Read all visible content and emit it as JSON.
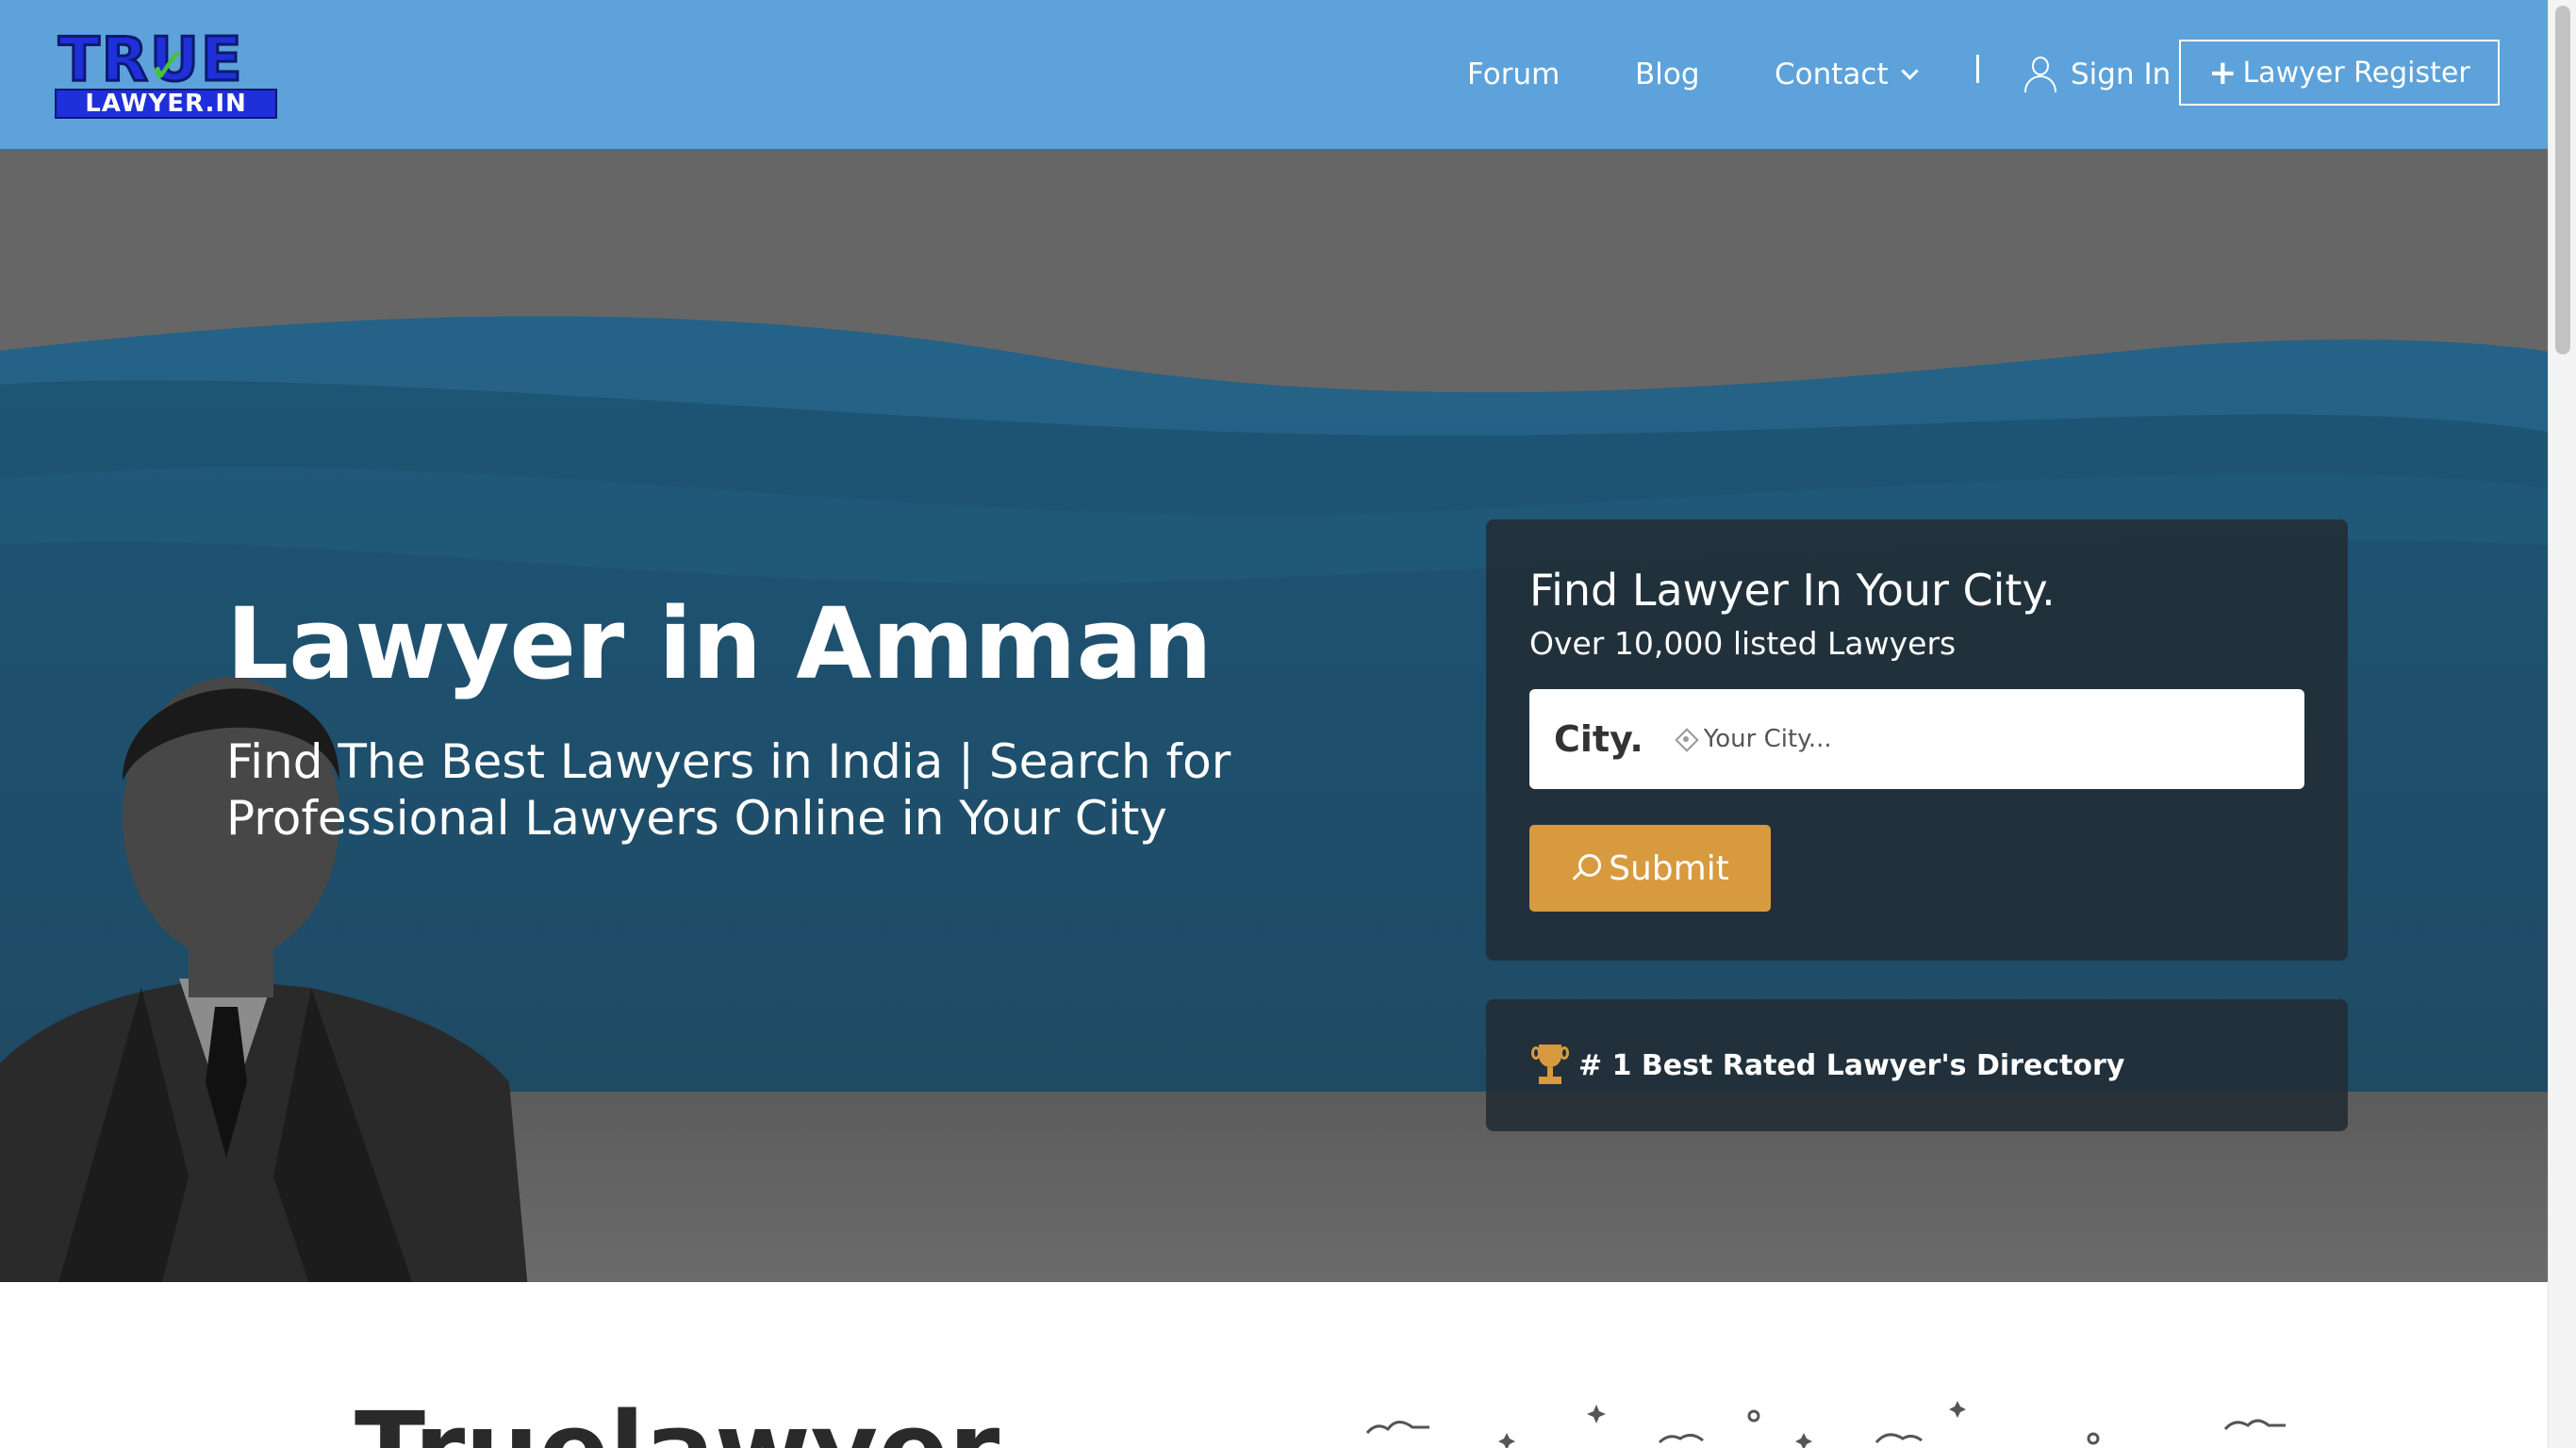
{
  "header": {
    "logo_top": "TRUE",
    "logo_bottom": "LAWYER.IN",
    "nav": {
      "forum": "Forum",
      "blog": "Blog",
      "contact": "Contact",
      "separator": "|",
      "sign_in": "Sign In",
      "register": "Lawyer Register"
    }
  },
  "hero": {
    "title": "Lawyer in Amman",
    "subtitle": "Find The Best Lawyers in India | Search for Professional Lawyers Online in Your City"
  },
  "search": {
    "heading": "Find Lawyer In Your City.",
    "count": "Over 10,000 listed Lawyers",
    "city_label": "City.",
    "city_placeholder": "Your City...",
    "submit_label": "Submit"
  },
  "badge": {
    "text": "# 1 Best Rated Lawyer's Directory"
  },
  "lower": {
    "heading": "Truelawyer"
  },
  "icons": [
    "user-icon",
    "plus-icon",
    "crosshair-icon",
    "search-icon",
    "trophy-icon",
    "chevron-down-icon"
  ],
  "colors": {
    "header_bg": "#5da2da",
    "hero_band": "#1e5a7c",
    "panel_bg": "#222c34",
    "submit_bg": "#d79a3f"
  }
}
